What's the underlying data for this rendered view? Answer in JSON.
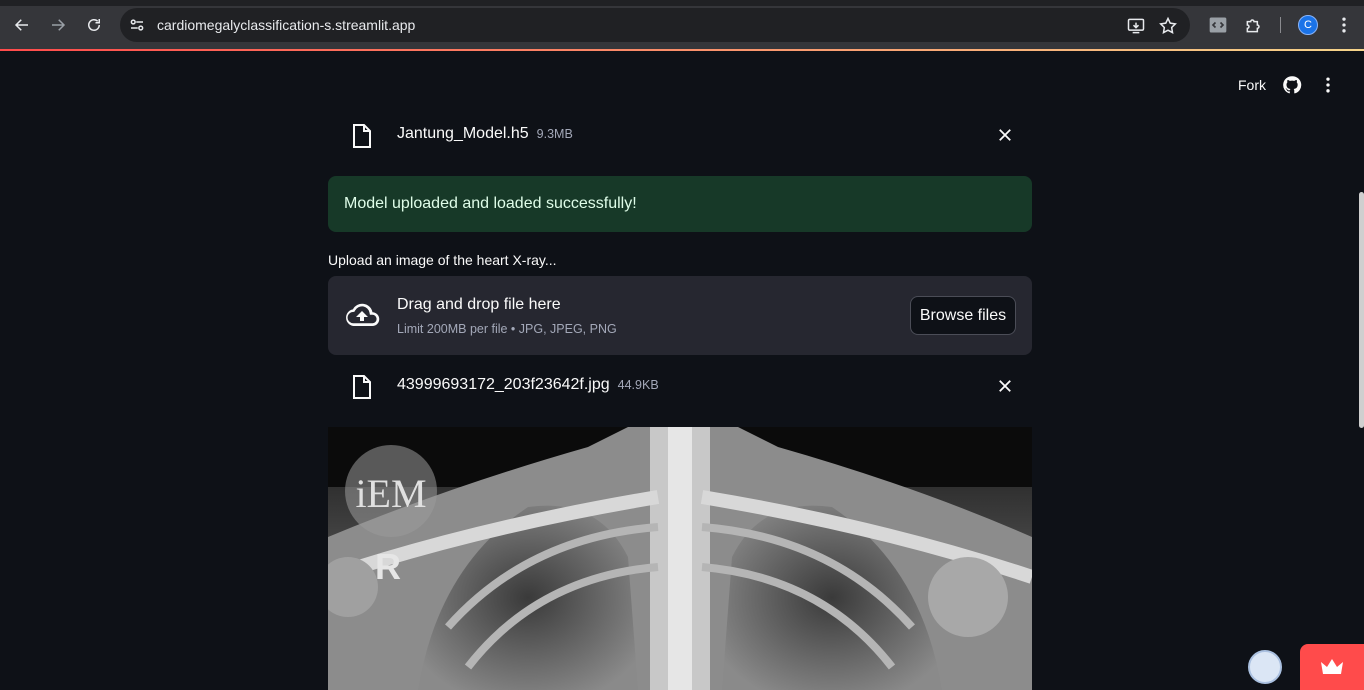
{
  "browser": {
    "url": "cardiomegalyclassification-s.streamlit.app",
    "profile_initial": "C"
  },
  "header": {
    "fork_label": "Fork"
  },
  "model_file": {
    "name": "Jantung_Model.h5",
    "size": "9.3MB"
  },
  "success_message": "Model uploaded and loaded successfully!",
  "uploader": {
    "label": "Upload an image of the heart X-ray...",
    "drop_title": "Drag and drop file here",
    "drop_subtitle": "Limit 200MB per file • JPG, JPEG, PNG",
    "browse_label": "Browse files"
  },
  "image_file": {
    "name": "43999693172_203f23642f.jpg",
    "size": "44.9KB"
  },
  "xray": {
    "watermark": "iEM",
    "side_marker": "R"
  },
  "colors": {
    "background": "#0e1117",
    "success_bg": "#173928",
    "success_text": "#dffde9",
    "dropzone_bg": "#262730",
    "accent": "#ff4b4b"
  }
}
